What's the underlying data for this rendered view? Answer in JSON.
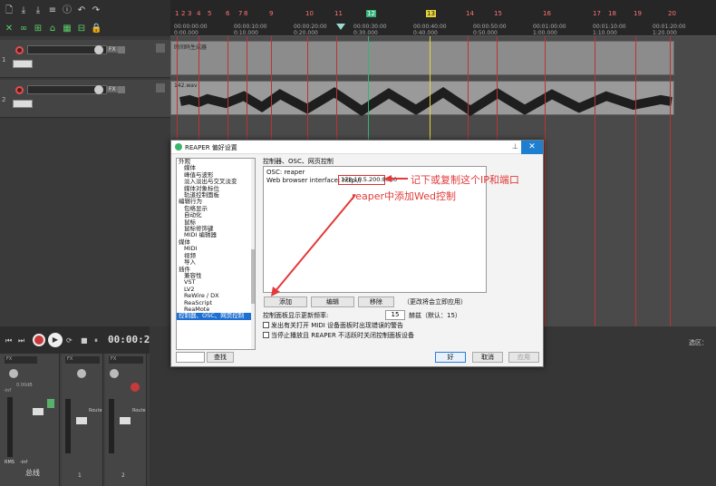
{
  "ruler": {
    "markers": [
      "1",
      "2",
      "3",
      "4",
      "5",
      "6",
      "7",
      "8",
      "9",
      "10",
      "11",
      "12",
      "13",
      "14",
      "15",
      "16",
      "17",
      "18",
      "19",
      "20"
    ],
    "timecodes": [
      "00:00:00:00",
      "00:00:10:00",
      "00:00:20:00",
      "00:00:30:00",
      "00:00:40:00",
      "00:00:50:00",
      "00:01:00:00",
      "00:01:10:00",
      "00:01:20:00"
    ],
    "times": [
      "0:00.000",
      "0:10.000",
      "0:20.000",
      "0:30.000",
      "0:40.000",
      "0:50.000",
      "1:00.000",
      "1:10.000",
      "1:20.000"
    ]
  },
  "tracks": [
    {
      "num": "1",
      "fx": "FX",
      "item_title": "时间码生成器"
    },
    {
      "num": "2",
      "fx": "FX",
      "item_title": "142.wav"
    }
  ],
  "transport": {
    "time": "00:00:28:00",
    "selection_label": "选区："
  },
  "mixer": {
    "master_label": "总线",
    "rms": "RMS",
    "inf": "-inf",
    "strip_nums": [
      "1",
      "2"
    ],
    "route": "Route",
    "fx": "FX",
    "db": "0.00dB",
    "meter_inf": "-inf"
  },
  "dialog": {
    "title": "REAPER 偏好设置",
    "section_title": "控制器、OSC、网页控制",
    "list_lines": [
      "OSC: reaper",
      "Web browser interface: http://"
    ],
    "ip_text": "172.16.5.200:8080",
    "add": "添加",
    "edit": "编辑",
    "remove": "移除",
    "note": "（更改将会立即应用）",
    "refresh_label": "控制面板显示更新频率:",
    "refresh_value": "15",
    "refresh_unit": "赫兹（默认：15）",
    "check1": "发出有关打开 MIDI 设备面板时出现错误的警告",
    "check2": "当停止播放且 REAPER 不活跃时关闭控制面板设备",
    "search_placeholder": "",
    "find": "查找",
    "ok": "好",
    "cancel": "取消",
    "apply": "应用",
    "tree": [
      "外观",
      "媒体",
      "峰值与波形",
      "淡入淡出与交叉淡变",
      "媒体对象标位",
      "轨道控制面板",
      "编辑行为",
      "包络显示",
      "自动化",
      "鼠标",
      "鼠标修饰键",
      "MIDI 编辑器",
      "媒体",
      "MIDI",
      "视频",
      "导入",
      "插件",
      "兼容性",
      "VST",
      "LV2",
      "ReWire / DX",
      "ReaScript",
      "ReaMote",
      "控制器、OSC、网页控制"
    ]
  },
  "annotations": {
    "a1": "记下或复制这个IP和端口",
    "a2": "reaper中添加Wed控制"
  },
  "colors": {
    "accent": "#1e7fd1",
    "annotation": "#e23a3a",
    "marker": "#ff7373"
  }
}
